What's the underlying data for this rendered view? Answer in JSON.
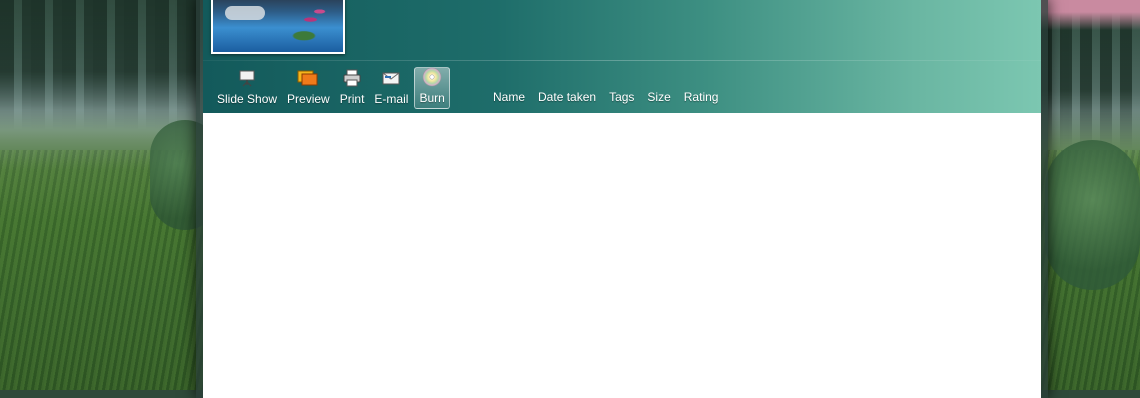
{
  "toolbar": {
    "buttons": [
      {
        "label": "Slide Show",
        "icon": "slideshow-icon"
      },
      {
        "label": "Preview",
        "icon": "preview-icon"
      },
      {
        "label": "Print",
        "icon": "printer-icon"
      },
      {
        "label": "E-mail",
        "icon": "email-icon"
      },
      {
        "label": "Burn",
        "icon": "disc-icon",
        "active": true
      }
    ]
  },
  "sort_options": [
    "Name",
    "Date taken",
    "Tags",
    "Size",
    "Rating"
  ],
  "colors": {
    "header_start": "#135a5b",
    "header_end": "#7cc7b1",
    "content_bg": "#ffffff"
  }
}
